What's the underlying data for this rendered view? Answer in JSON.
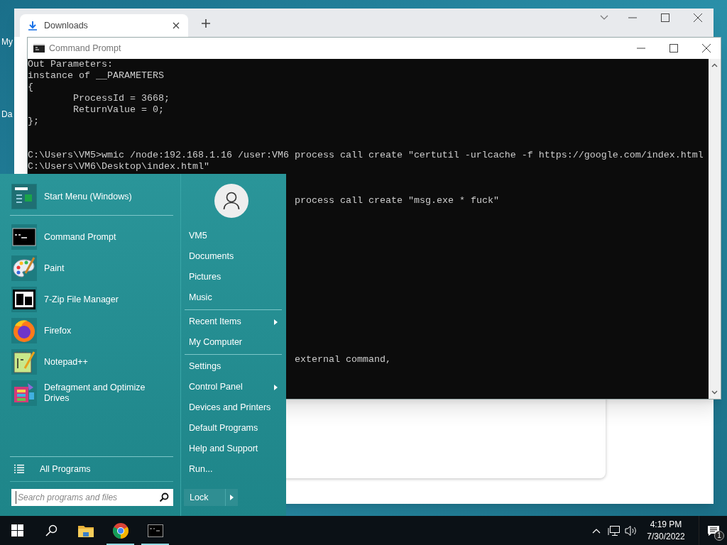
{
  "desktop": {
    "icons": [
      {
        "label": "My"
      },
      {
        "label": "Da"
      }
    ]
  },
  "browser": {
    "tabs": [
      {
        "label": "Downloads",
        "selected": true
      }
    ]
  },
  "command_prompt": {
    "title": "Command Prompt",
    "lines": [
      {
        "kind": "line",
        "text": "Out Parameters:"
      },
      {
        "kind": "line",
        "text": "instance of __PARAMETERS"
      },
      {
        "kind": "line",
        "text": "{"
      },
      {
        "kind": "indent",
        "text": "ProcessId = 3668;"
      },
      {
        "kind": "indent",
        "text": "ReturnValue = 0;"
      },
      {
        "kind": "line",
        "text": "};"
      },
      {
        "kind": "blank"
      },
      {
        "kind": "blank"
      },
      {
        "kind": "line",
        "text": "C:\\Users\\VM5>wmic /node:192.168.1.16 /user:VM6 process call create \"certutil -urlcache -f https://google.com/index.html"
      },
      {
        "kind": "line",
        "text": "C:\\Users\\VM6\\Desktop\\index.html\""
      },
      {
        "kind": "blank"
      },
      {
        "kind": "blank"
      },
      {
        "kind": "tail",
        "text": "process call create \"msg.exe * fuck\""
      },
      {
        "kind": "blank"
      },
      {
        "kind": "blank"
      },
      {
        "kind": "blank"
      },
      {
        "kind": "blank"
      },
      {
        "kind": "blank"
      },
      {
        "kind": "blank"
      },
      {
        "kind": "blank"
      },
      {
        "kind": "blank"
      },
      {
        "kind": "blank"
      },
      {
        "kind": "blank"
      },
      {
        "kind": "blank"
      },
      {
        "kind": "blank"
      },
      {
        "kind": "blank"
      },
      {
        "kind": "tail",
        "text": "external command,"
      }
    ]
  },
  "start_menu": {
    "pinned": [
      {
        "label": "Start Menu (Windows)",
        "kind": "start"
      }
    ],
    "programs": [
      {
        "label": "Command Prompt",
        "kind": "cmd"
      },
      {
        "label": "Paint",
        "kind": "paint"
      },
      {
        "label": "7-Zip File Manager",
        "kind": "zip"
      },
      {
        "label": "Firefox",
        "kind": "firefox"
      },
      {
        "label": "Notepad++",
        "kind": "notepad"
      },
      {
        "label": "Defragment and Optimize Drives",
        "kind": "defrag"
      }
    ],
    "all_programs": "All Programs",
    "search": {
      "placeholder": "Search programs and files"
    },
    "places": [
      [
        {
          "label": "VM5",
          "submenu": false
        },
        {
          "label": "Documents",
          "submenu": false
        },
        {
          "label": "Pictures",
          "submenu": false
        },
        {
          "label": "Music",
          "submenu": false
        }
      ],
      [
        {
          "label": "Recent Items",
          "submenu": true
        },
        {
          "label": "My Computer",
          "submenu": false
        }
      ],
      [
        {
          "label": "Settings",
          "submenu": false
        },
        {
          "label": "Control Panel",
          "submenu": true
        },
        {
          "label": "Devices and Printers",
          "submenu": false
        },
        {
          "label": "Default Programs",
          "submenu": false
        },
        {
          "label": "Help and Support",
          "submenu": false
        },
        {
          "label": "Run...",
          "submenu": false
        }
      ]
    ],
    "lock": "Lock"
  },
  "taskbar": {
    "apps": [
      {
        "kind": "explorer",
        "running": false
      },
      {
        "kind": "chrome",
        "running": true
      },
      {
        "kind": "cmd",
        "running": true
      }
    ],
    "time": "4:19 PM",
    "date": "7/30/2022",
    "notifications": "1"
  }
}
